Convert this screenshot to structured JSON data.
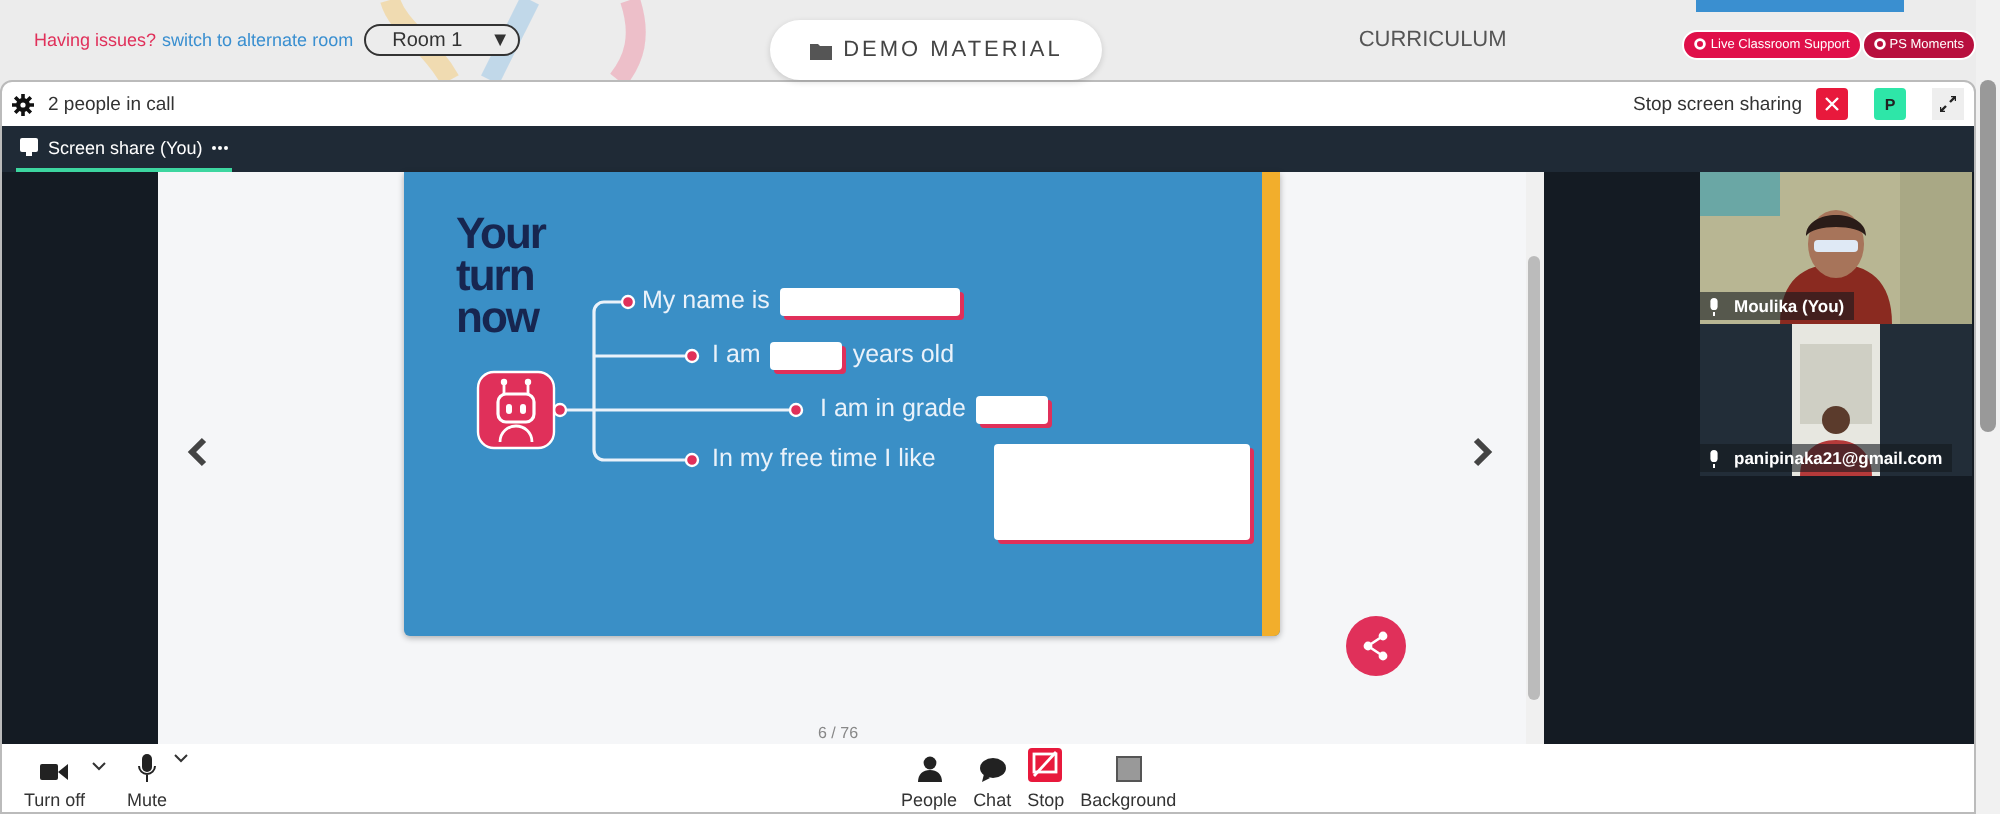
{
  "top_bar": {
    "issue_text": "Having issues?",
    "switch_link": "switch to alternate room",
    "room_select": {
      "value": "Room 1",
      "caret": "▼"
    },
    "tabs": [
      {
        "label": "DEMO MATERIAL",
        "selected": true
      },
      {
        "label": "CURRICULUM",
        "selected": false
      }
    ],
    "buttons": [
      {
        "label": "Live Classroom Support",
        "color": "#e0104a"
      },
      {
        "label": "PS Moments",
        "color": "#b8103e"
      }
    ]
  },
  "call_header": {
    "people_count": "2 people in call",
    "stop_sharing": "Stop screen sharing",
    "avatar_letter": "P"
  },
  "stage_tab": {
    "label": "Screen share (You)",
    "selected": true
  },
  "slide": {
    "title": "Your turn now",
    "prompts": [
      {
        "before": "My name is",
        "kind": "long"
      },
      {
        "before": "I am",
        "kind": "short",
        "after": "years old"
      },
      {
        "before": "I am in grade",
        "kind": "short"
      },
      {
        "before": "In my free time I like",
        "kind": "large"
      }
    ]
  },
  "page_indicator": "6 / 76",
  "participants": [
    {
      "name": "Moulika (You)",
      "kind": "full"
    },
    {
      "name": "panipinaka21@gmail.com",
      "kind": "portrait"
    }
  ],
  "toolbar": {
    "left": [
      {
        "label": "Turn off",
        "kind": "camera",
        "dropdown": true
      },
      {
        "label": "Mute",
        "kind": "mic",
        "dropdown": true
      }
    ],
    "center": [
      {
        "label": "People",
        "kind": "people"
      },
      {
        "label": "Chat",
        "kind": "chat"
      },
      {
        "label": "Stop",
        "kind": "stop"
      },
      {
        "label": "Background",
        "kind": "background"
      }
    ]
  }
}
